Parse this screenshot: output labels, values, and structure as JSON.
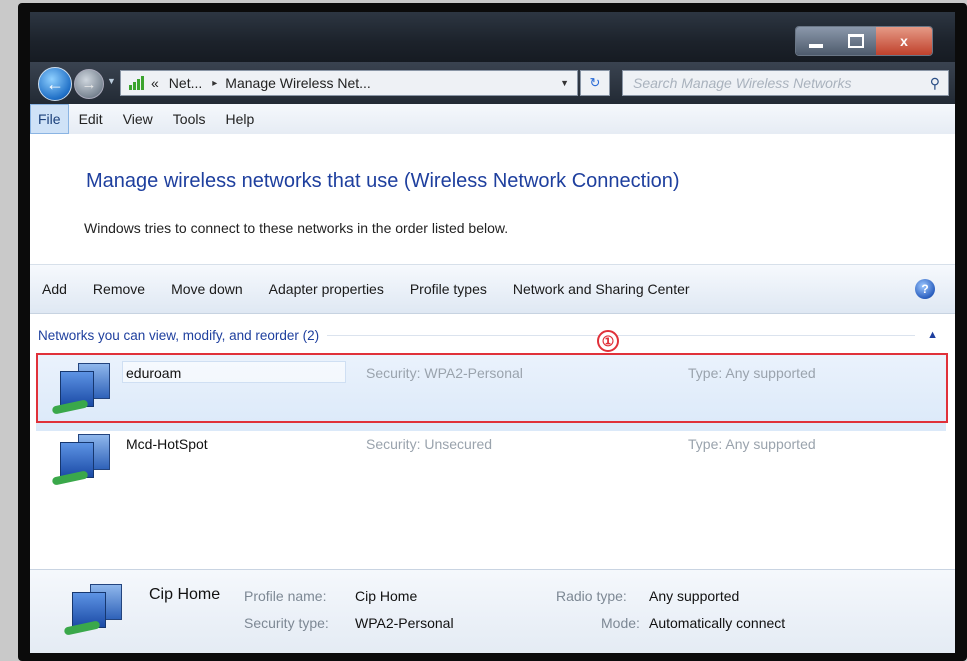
{
  "window": {
    "minimize_glyph": "",
    "maximize_glyph": "",
    "close_glyph": "x"
  },
  "nav": {
    "back_glyph": "←",
    "forward_glyph": "→",
    "breadcrumb": [
      "«",
      "Net...",
      "▸",
      "Manage Wireless Net..."
    ],
    "search_placeholder": "Search Manage Wireless Networks"
  },
  "menu": [
    "File",
    "Edit",
    "View",
    "Tools",
    "Help"
  ],
  "main": {
    "heading": "Manage wireless networks that use (Wireless Network Connection)",
    "subtitle": "Windows tries to connect to these networks in the order listed below."
  },
  "toolbar": [
    "Add",
    "Remove",
    "Move down",
    "Adapter properties",
    "Profile types",
    "Network and Sharing Center"
  ],
  "group": {
    "label": "Networks you can view, modify, and reorder (2)"
  },
  "networks": [
    {
      "name": "eduroam",
      "security": "Security: WPA2-Personal",
      "type": "Type: Any supported"
    },
    {
      "name": "Mcd-HotSpot",
      "security": "Security: Unsecured",
      "type": "Type: Any supported"
    }
  ],
  "annotation": {
    "badge": "①"
  },
  "details": {
    "name": "Cip Home",
    "profile_label": "Profile name:",
    "profile_value": "Cip Home",
    "security_label": "Security type:",
    "security_value": "WPA2-Personal",
    "radio_label": "Radio type:",
    "radio_value": "Any supported",
    "mode_label": "Mode:",
    "mode_value": "Automatically connect"
  },
  "colors": {
    "accent_link": "#1e3f9e",
    "highlight_box": "#e0313a",
    "selected_row": "#dbe9f9"
  }
}
